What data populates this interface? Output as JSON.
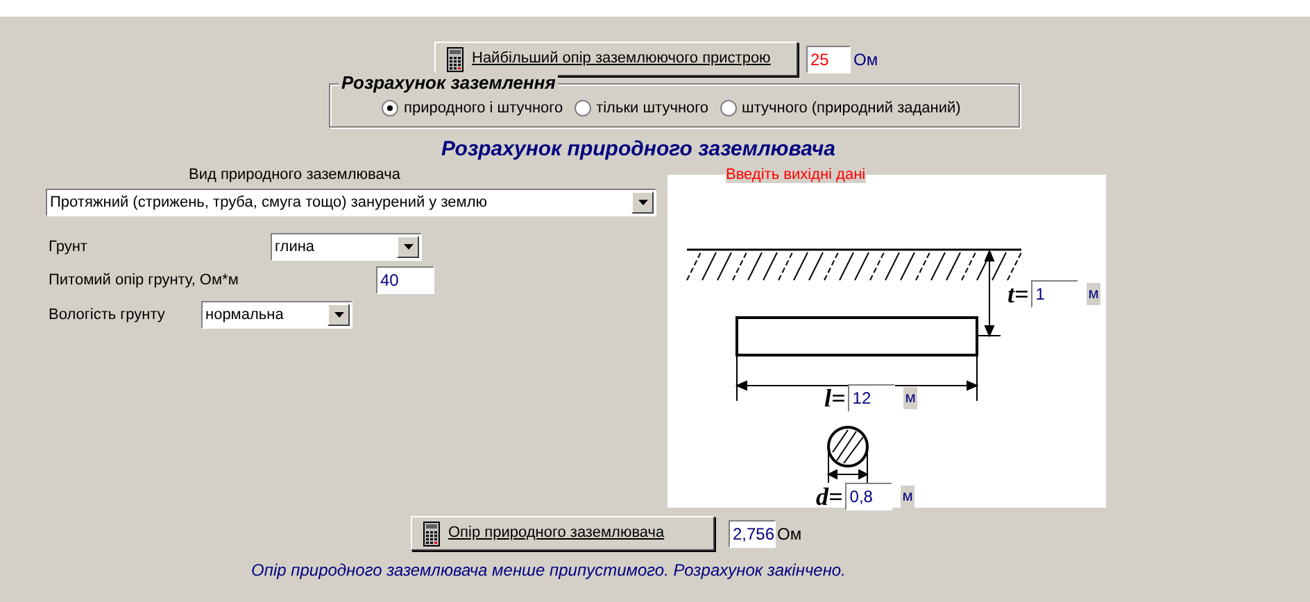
{
  "max_resistance": {
    "button": "Найбільший опір заземлюючого пристрою",
    "value": "25",
    "unit": "Ом"
  },
  "grounding_calculation": {
    "legend": "Розрахунок заземлення",
    "options": [
      {
        "label": "природного і штучного",
        "selected": true
      },
      {
        "label": "тільки штучного",
        "selected": false
      },
      {
        "label": "штучного (природний заданий)",
        "selected": false
      }
    ]
  },
  "section_title": "Розрахунок природного заземлювача",
  "electrode_type": {
    "label": "Вид природного заземлювача",
    "value": "Протяжний (стрижень, труба, смуга тощо) занурений у землю"
  },
  "fields": [
    {
      "kind": "select",
      "label": "Грунт",
      "value": "глина"
    },
    {
      "kind": "input",
      "label": "Питомий опір грунту, Ом*м",
      "value": "40"
    },
    {
      "kind": "select",
      "label": "Вологість грунту",
      "value": "нормальна"
    }
  ],
  "diagram": {
    "hint": "Введіть вихідні дані",
    "depth": {
      "label": "t=",
      "value": "1",
      "unit": "м"
    },
    "length": {
      "label": "l=",
      "value": "12",
      "unit": "м"
    },
    "diameter": {
      "label": "d=",
      "value": "0,8",
      "unit": "м"
    }
  },
  "result": {
    "button": "Опір природного заземлювача",
    "value": "2,756",
    "unit": "Ом"
  },
  "message": "Опір природного заземлювача менше припустимого. Розрахунок закінчено."
}
